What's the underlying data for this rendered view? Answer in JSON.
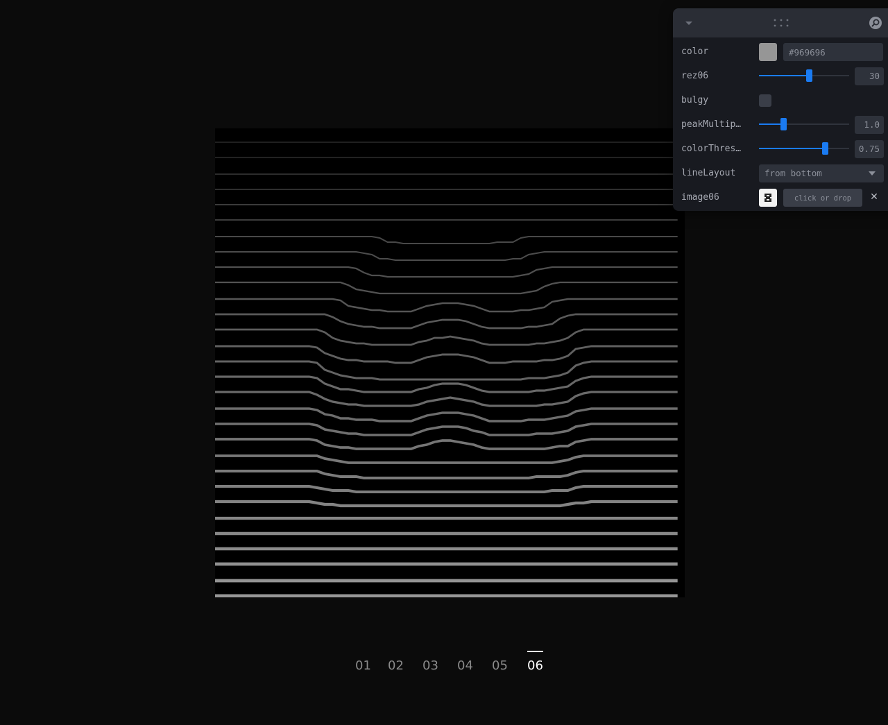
{
  "canvas": {
    "stroke_color": "#969696",
    "background": "#000000",
    "line_count": 30
  },
  "panel": {
    "rows": [
      {
        "label": "color",
        "value": "#969696",
        "swatch_color": "#969696"
      },
      {
        "label": "rez06",
        "value": "30",
        "fraction": 0.55
      },
      {
        "label": "bulgy",
        "checked": false
      },
      {
        "label": "peakMultip…",
        "value": "1.0",
        "fraction": 0.27
      },
      {
        "label": "colorThres…",
        "value": "0.75",
        "fraction": 0.73
      },
      {
        "label": "lineLayout",
        "value": "from bottom"
      },
      {
        "label": "image06",
        "drop_label": "click or drop",
        "clear_label": "✕"
      }
    ],
    "accent_color": "#1a7bf2",
    "icons": [
      "chevron-down-icon",
      "drag-handle-icon",
      "search-icon"
    ]
  },
  "nav": {
    "items": [
      "01",
      "02",
      "03",
      "04",
      "05",
      "06"
    ],
    "active_index": 5
  }
}
